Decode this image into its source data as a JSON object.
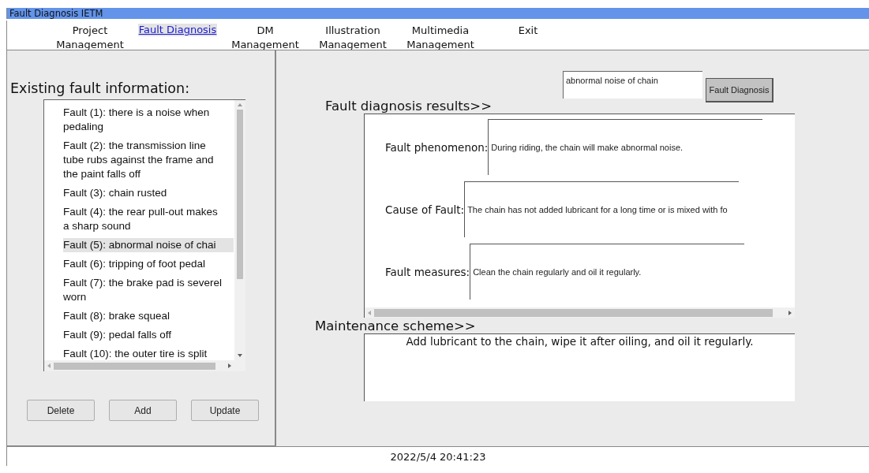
{
  "window": {
    "title": "Fault Diagnosis IETM"
  },
  "menu": [
    {
      "label": "Project Management",
      "selected": false
    },
    {
      "label": "Fault Diagnosis",
      "selected": true
    },
    {
      "label": "DM Management",
      "selected": false
    },
    {
      "label": "Illustration Management",
      "selected": false
    },
    {
      "label": "Multimedia Management",
      "selected": false
    },
    {
      "label": "Exit",
      "selected": false
    }
  ],
  "fault_list": {
    "heading": "Existing fault information:",
    "items": [
      {
        "lines": [
          "Fault (1): there is a noise when",
          "pedaling"
        ],
        "selected": false
      },
      {
        "lines": [
          "Fault (2): the transmission line",
          "tube rubs against the frame and",
          "the paint falls off"
        ],
        "selected": false
      },
      {
        "lines": [
          "Fault (3): chain rusted"
        ],
        "selected": false
      },
      {
        "lines": [
          "Fault (4): the rear pull-out makes",
          "a sharp sound"
        ],
        "selected": false
      },
      {
        "lines": [
          "Fault (5): abnormal noise of chai"
        ],
        "selected": true
      },
      {
        "lines": [
          "Fault (6): tripping of foot pedal"
        ],
        "selected": false
      },
      {
        "lines": [
          "Fault (7): the brake pad is severel",
          "worn"
        ],
        "selected": false
      },
      {
        "lines": [
          "Fault (8): brake squeal"
        ],
        "selected": false
      },
      {
        "lines": [
          "Fault (9): pedal falls off"
        ],
        "selected": false
      },
      {
        "lines": [
          "Fault (10): the outer tire is split"
        ],
        "selected": false
      }
    ],
    "buttons": [
      "Delete",
      "Add",
      "Update"
    ]
  },
  "search": {
    "value": "abnormal noise of chain",
    "button": "Fault Diagnosis"
  },
  "results": {
    "heading": "Fault diagnosis results>>",
    "rows": [
      {
        "label": "Fault phenomenon:",
        "value": "During riding, the chain will make abnormal noise."
      },
      {
        "label": "Cause of Fault:",
        "value": "The chain has not added lubricant for a long time or is mixed with fo"
      },
      {
        "label": "Fault measures:",
        "value": "Clean the chain regularly and oil it regularly."
      }
    ]
  },
  "maintenance": {
    "heading": "Maintenance scheme>>",
    "text": "Add lubricant to the chain, wipe it after oiling, and oil it regularly."
  },
  "status_bar": {
    "datetime": "2022/5/4 20:41:23"
  }
}
